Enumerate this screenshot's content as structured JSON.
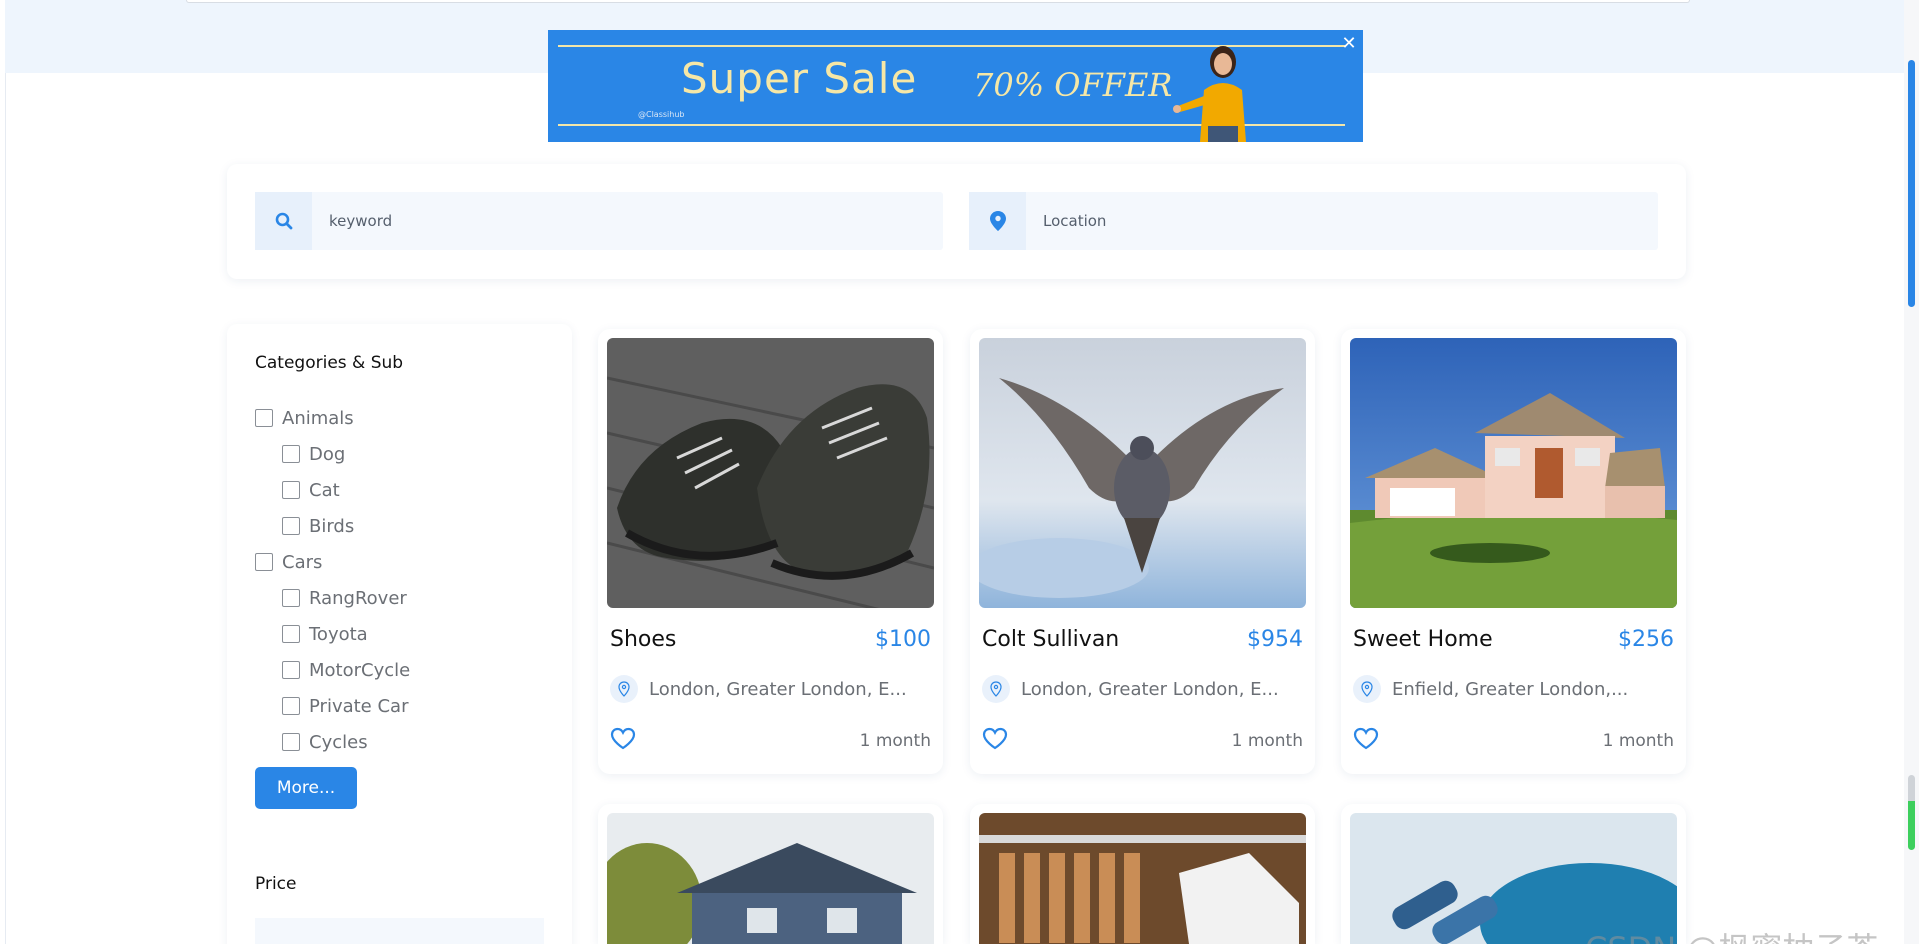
{
  "banner": {
    "headline": "Super Sale",
    "offer": "70% OFFER",
    "brand": "@Classihub",
    "close_label": "✕"
  },
  "search": {
    "keyword_placeholder": "keyword",
    "location_placeholder": "Location"
  },
  "sidebar": {
    "categories_title": "Categories & Sub",
    "categories": [
      {
        "label": "Animals",
        "level": 0
      },
      {
        "label": "Dog",
        "level": 1
      },
      {
        "label": "Cat",
        "level": 1
      },
      {
        "label": "Birds",
        "level": 1
      },
      {
        "label": "Cars",
        "level": 0
      },
      {
        "label": "RangRover",
        "level": 1
      },
      {
        "label": "Toyota",
        "level": 1
      },
      {
        "label": "MotorCycle",
        "level": 1
      },
      {
        "label": "Private Car",
        "level": 1
      },
      {
        "label": "Cycles",
        "level": 1
      }
    ],
    "more_label": "More...",
    "price_title": "Price"
  },
  "listings": [
    {
      "title": "Shoes",
      "price": "$100",
      "location": "London, Greater London, E...",
      "time": "1 month"
    },
    {
      "title": "Colt Sullivan",
      "price": "$954",
      "location": "London, Greater London, E...",
      "time": "1 month"
    },
    {
      "title": "Sweet Home",
      "price": "$256",
      "location": "Enfield, Greater London,...",
      "time": "1 month"
    }
  ],
  "watermark": "CSDN @枫蜜柚子茶",
  "colors": {
    "accent": "#2a86e6",
    "banner_text": "#f6e7a6"
  }
}
